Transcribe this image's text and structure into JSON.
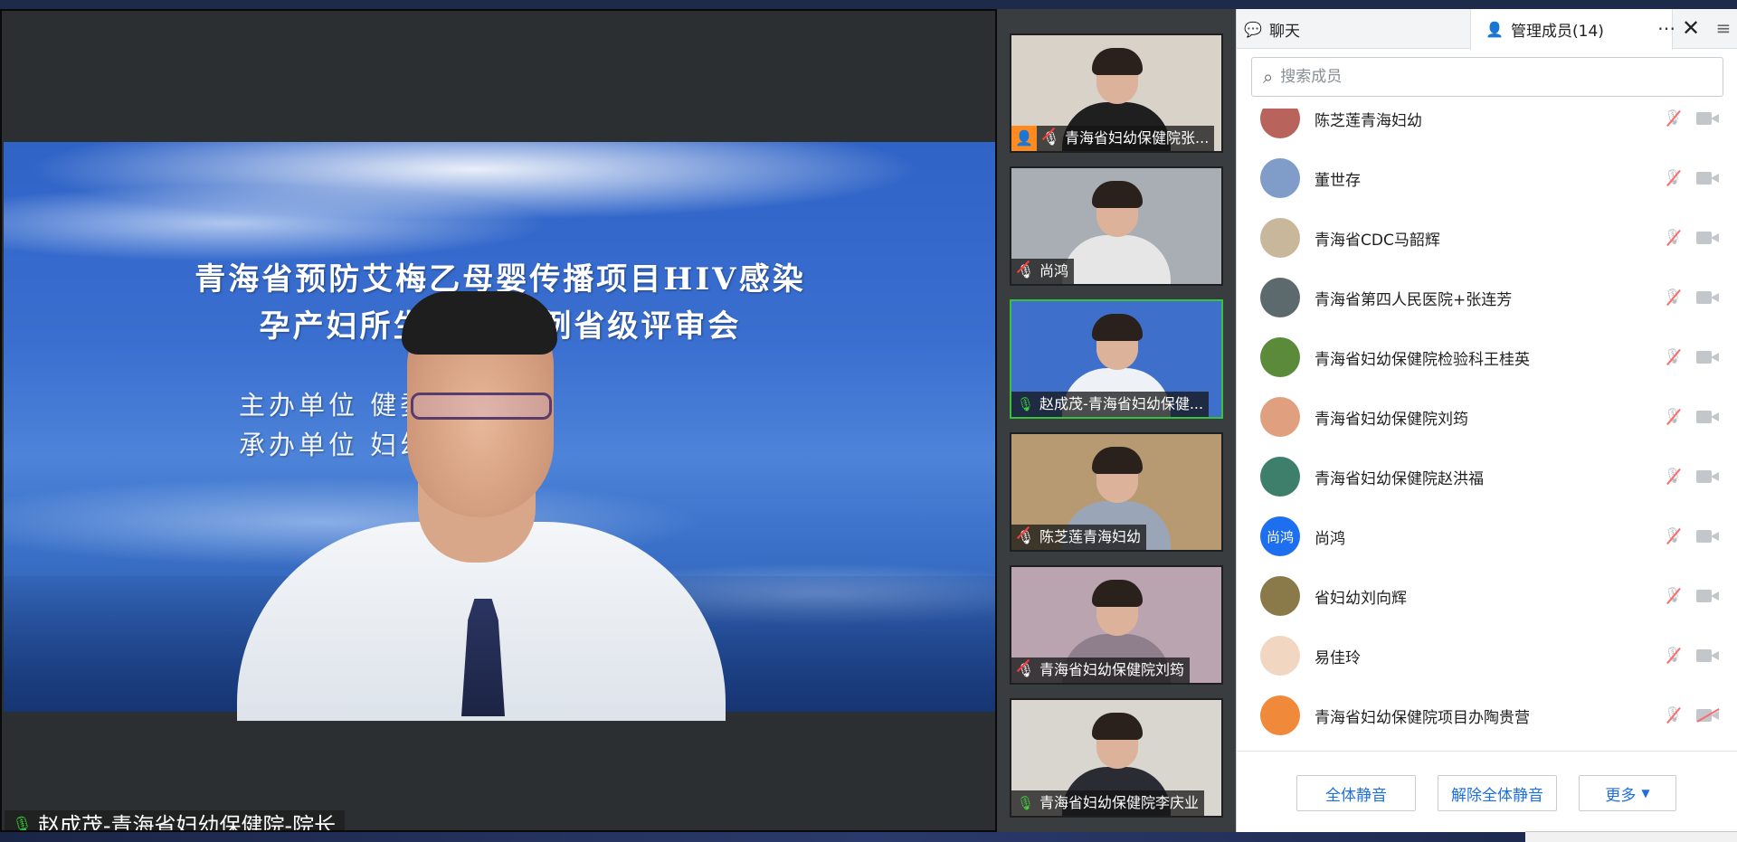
{
  "main_video": {
    "slide_title_line1": "青海省预防艾梅乙母婴传播项目HIV感染",
    "slide_title_line2": "孕产妇所生儿童 案例省级评审会",
    "slide_line1": "主办单位 健委妇幼处",
    "slide_line2": "承办单位 妇幼保健院",
    "speaker_name": "赵成茂-青海省妇幼保健院-院长"
  },
  "thumbnails": [
    {
      "label": "青海省妇幼保健院张...",
      "mic": "off",
      "host": true,
      "bg": "#d8d2c8",
      "body": "#1f1f1f"
    },
    {
      "label": "尚鸿",
      "mic": "off",
      "host": false,
      "bg": "#a9aeb4",
      "body": "#e6e6e6"
    },
    {
      "label": "赵成茂-青海省妇幼保健...",
      "mic": "on",
      "host": false,
      "bg": "#3d6fcb",
      "body": "#eef1f5",
      "active": true
    },
    {
      "label": "陈芝莲青海妇幼",
      "mic": "off",
      "host": false,
      "bg": "#b89a72",
      "body": "#9aa6b8"
    },
    {
      "label": "青海省妇幼保健院刘筠",
      "mic": "off",
      "host": false,
      "bg": "#b9a4b0",
      "body": "#8f7f8c"
    },
    {
      "label": "青海省妇幼保健院李庆业",
      "mic": "on",
      "host": false,
      "bg": "#d9d6cf",
      "body": "#2b2b33"
    }
  ],
  "panel": {
    "tab_chat": "聊天",
    "tab_members": "管理成员(14)",
    "search_placeholder": "搜索成员",
    "members": [
      {
        "name": "陈芝莲青海妇幼",
        "avatar_color": "#b8645c",
        "cam_off": false
      },
      {
        "name": "董世存",
        "avatar_color": "#7f9dc8",
        "cam_off": false
      },
      {
        "name": "青海省CDC马韶辉",
        "avatar_color": "#c9b79b",
        "cam_off": false
      },
      {
        "name": "青海省第四人民医院+张连芳",
        "avatar_color": "#5c6a6e",
        "cam_off": false
      },
      {
        "name": "青海省妇幼保健院检验科王桂英",
        "avatar_color": "#5a8a3a",
        "cam_off": false
      },
      {
        "name": "青海省妇幼保健院刘筠",
        "avatar_color": "#e0a080",
        "cam_off": false
      },
      {
        "name": "青海省妇幼保健院赵洪福",
        "avatar_color": "#3d7f6a",
        "cam_off": false
      },
      {
        "name": "尚鸿",
        "avatar_color": "#1e6ff0",
        "avatar_text": "尚鸿",
        "cam_off": false
      },
      {
        "name": "省妇幼刘向辉",
        "avatar_color": "#8a7a4a",
        "cam_off": false
      },
      {
        "name": "易佳玲",
        "avatar_color": "#f1d6c2",
        "cam_off": false
      },
      {
        "name": "青海省妇幼保健院项目办陶贵营",
        "avatar_color": "#f08a3a",
        "cam_off": true
      }
    ],
    "btn_mute_all": "全体静音",
    "btn_unmute_all": "解除全体静音",
    "btn_more": "更多"
  }
}
